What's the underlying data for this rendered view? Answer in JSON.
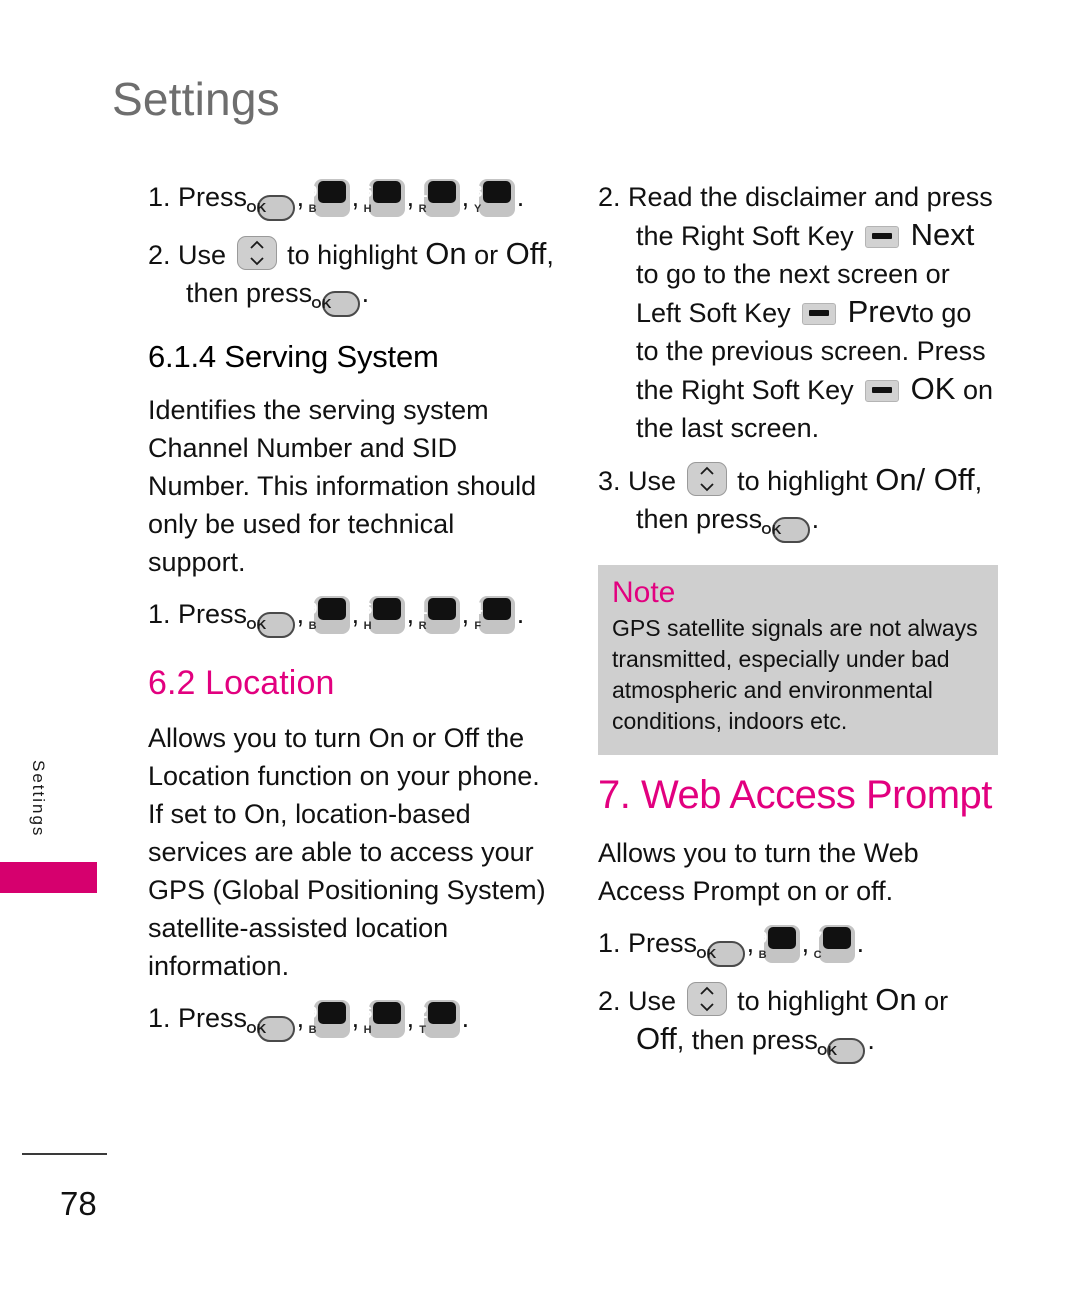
{
  "header": {
    "title": "Settings"
  },
  "side_tab": {
    "label": "Settings",
    "color": "#d6006e"
  },
  "footer": {
    "page_number": "78"
  },
  "colors": {
    "accent_magenta": "#e2007f",
    "tab_magenta": "#d6006e",
    "title_gray": "#6e6e6e",
    "note_bg": "#cfcfcf"
  },
  "left_column": {
    "step_1_press_label": "1. Press",
    "step_1_keys": [
      "OK",
      "9B",
      "6H",
      "1R",
      "3Y"
    ],
    "step_2_use_label": "2. Use",
    "step_2_text_a": "to highlight",
    "step_2_on": "On",
    "step_2_or": "or",
    "step_2_off": "Off",
    "step_2_text_b": ", then press",
    "heading_serving_system": "6.1.4 Serving System",
    "serving_system_body": "Identifies the serving system Channel Number and SID Number. This information should only be used for technical support.",
    "serving_step_1_label": "1. Press",
    "serving_step_1_keys": [
      "OK",
      "9B",
      "6H",
      "1R",
      "4F"
    ],
    "heading_location": "6.2 Location",
    "location_body": "Allows you to turn On or Off the Location function on your phone. If set to On, location-based services are able to access your GPS (Global Positioning System) satellite-assisted location information.",
    "location_step_1_label": "1. Press",
    "location_step_1_keys": [
      "OK",
      "9B",
      "6H",
      "2T"
    ]
  },
  "right_column": {
    "step_2_lead": "2. Read the disclaimer and press",
    "step_2_right_soft_key_label": "the Right Soft Key",
    "step_2_next": "Next",
    "step_2_mid": "to go to the next screen or",
    "step_2_left_soft_key_label": "Left Soft Key",
    "step_2_prev": "Prev",
    "step_2_prev_tail": "to go",
    "step_2_tail": "to the previous screen. Press",
    "step_2_right_soft_key_label_2": "the Right Soft Key",
    "step_2_ok": "OK",
    "step_2_last": "on the last screen.",
    "step_3_use_label": "3. Use",
    "step_3_text_a": "to highlight",
    "step_3_onoff": "On/ Off",
    "step_3_comma": ",",
    "step_3_text_b": "then press",
    "note": {
      "title": "Note",
      "body": "GPS satellite signals are not always transmitted, especially under bad atmospheric and environmental conditions, indoors etc."
    },
    "heading_web_access": "7. Web Access Prompt",
    "web_access_body": "Allows you to turn the Web Access Prompt on or off.",
    "web_step_1_label": "1. Press",
    "web_step_1_keys": [
      "OK",
      "9B",
      "7C"
    ],
    "web_step_2_use_label": "2. Use",
    "web_step_2_text_a": "to highlight",
    "web_step_2_on": "On",
    "web_step_2_or": "or",
    "web_step_2_off": "Off",
    "web_step_2_text_b": ", then press"
  },
  "keys": {
    "OK": {
      "icon": "ok-key-icon",
      "label": "OK"
    },
    "9B": {
      "icon": "keypad-9-key-icon",
      "digit": "9",
      "letter": "B"
    },
    "6H": {
      "icon": "keypad-6-key-icon",
      "digit": "6",
      "letter": "H"
    },
    "1R": {
      "icon": "keypad-1-key-icon",
      "digit": "1",
      "letter": "R"
    },
    "3Y": {
      "icon": "keypad-3-key-icon",
      "digit": "3",
      "letter": "Y"
    },
    "4F": {
      "icon": "keypad-4-key-icon",
      "digit": "4",
      "letter": "F"
    },
    "2T": {
      "icon": "keypad-2-key-icon",
      "digit": "2",
      "letter": "T"
    },
    "7C": {
      "icon": "keypad-7-key-icon",
      "digit": "7",
      "letter": "C"
    },
    "NAV": {
      "icon": "navigation-updown-key-icon"
    },
    "SOFT": {
      "icon": "soft-key-icon"
    }
  }
}
